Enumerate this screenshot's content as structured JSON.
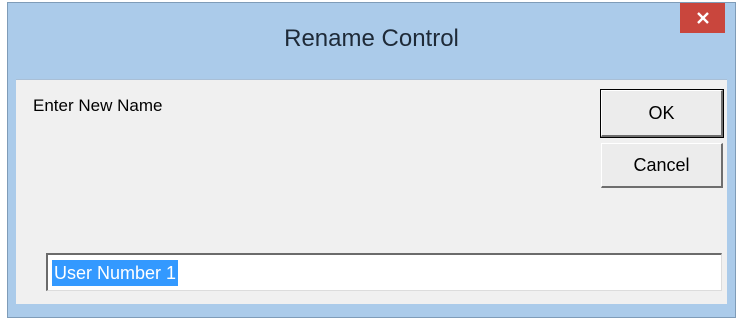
{
  "window": {
    "title": "Rename Control",
    "close_icon": "close-icon"
  },
  "dialog": {
    "prompt": "Enter New Name",
    "ok_label": "OK",
    "cancel_label": "Cancel",
    "name_value": "User Number 1",
    "name_value_selected": true
  },
  "colors": {
    "titlebar": "#abcbea",
    "close_button": "#c9463d",
    "client_background": "#f0f0f0",
    "selection": "#3399ff"
  }
}
